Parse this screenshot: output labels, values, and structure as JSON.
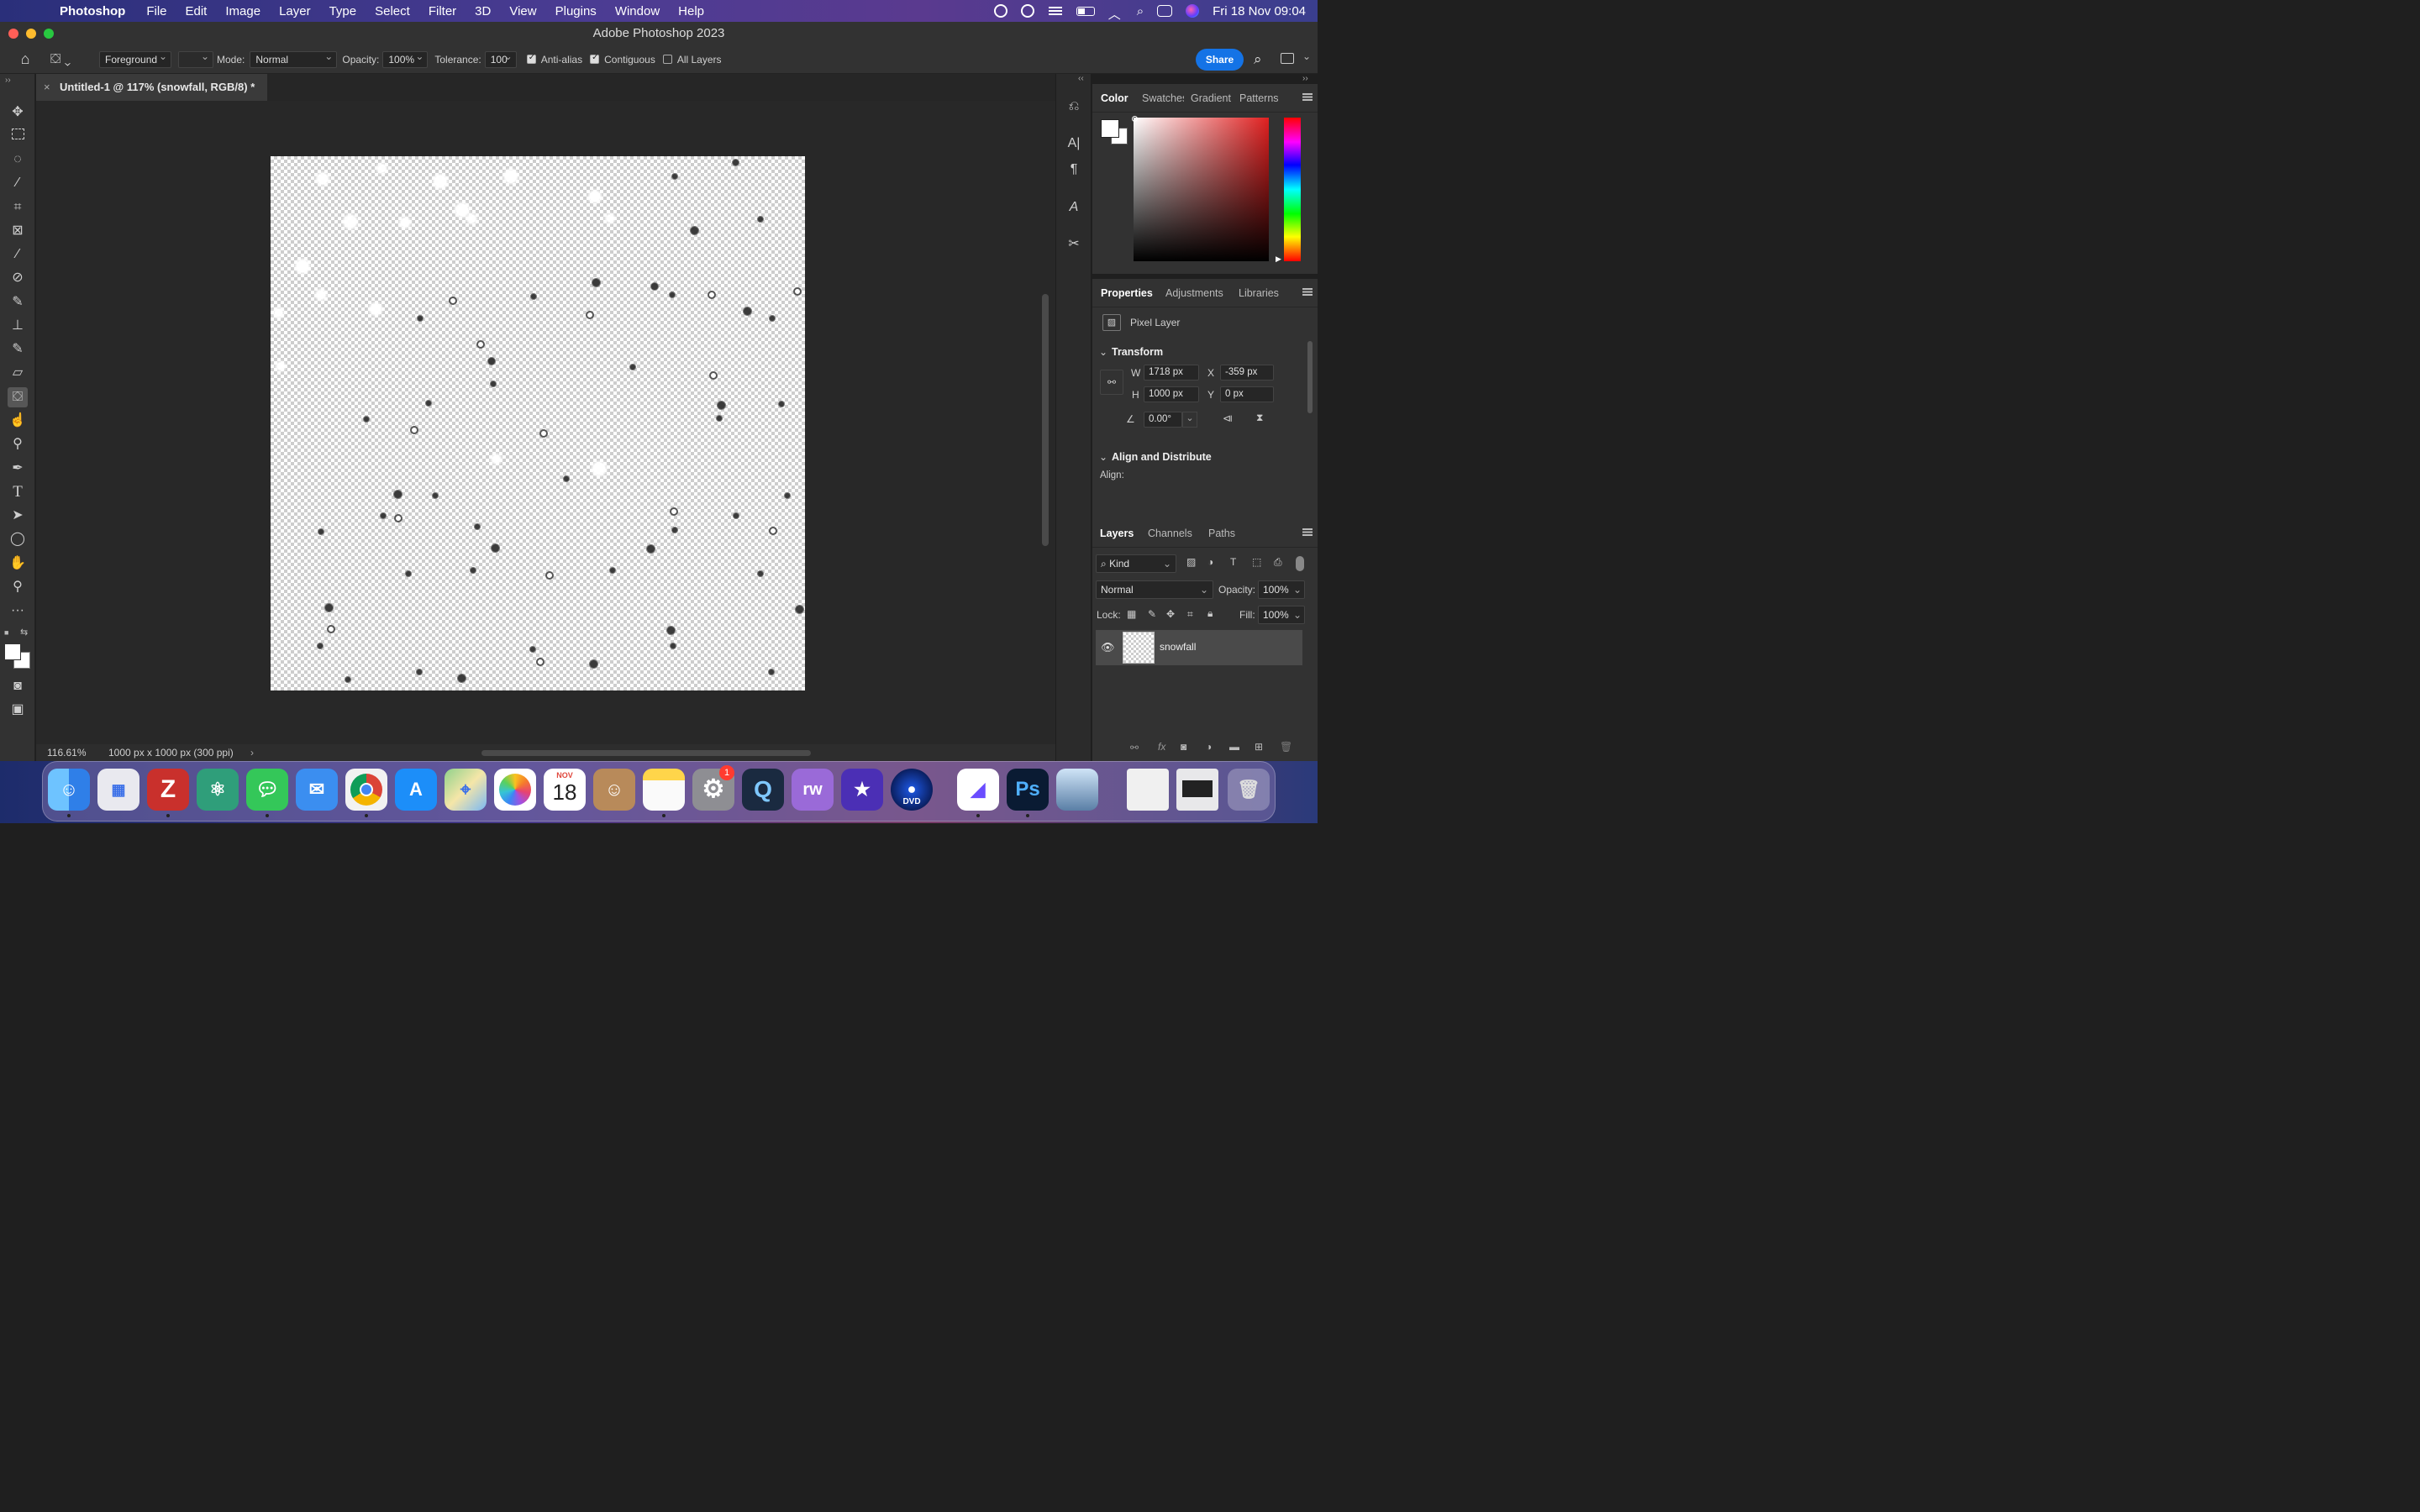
{
  "menubar": {
    "app_name": "Photoshop",
    "items": [
      "File",
      "Edit",
      "Image",
      "Layer",
      "Type",
      "Select",
      "Filter",
      "3D",
      "View",
      "Plugins",
      "Window",
      "Help"
    ],
    "clock": "Fri 18 Nov  09:04"
  },
  "window": {
    "title": "Adobe Photoshop 2023"
  },
  "options": {
    "fill_source": "Foreground",
    "mode_label": "Mode:",
    "mode_value": "Normal",
    "opacity_label": "Opacity:",
    "opacity_value": "100%",
    "tolerance_label": "Tolerance:",
    "tolerance_value": "100",
    "antialias_label": "Anti-alias",
    "contiguous_label": "Contiguous",
    "all_layers_label": "All Layers",
    "antialias_checked": true,
    "contiguous_checked": true,
    "all_layers_checked": false,
    "share_label": "Share"
  },
  "document": {
    "tab_title": "Untitled-1 @ 117% (snowfall, RGB/8) *",
    "zoom": "116.61%",
    "size_info": "1000 px x 1000 px (300 ppi)"
  },
  "color_panel": {
    "tabs": [
      "Color",
      "Swatches",
      "Gradient",
      "Patterns"
    ],
    "active_tab": "Color"
  },
  "properties_panel": {
    "tabs": [
      "Properties",
      "Adjustments",
      "Libraries"
    ],
    "layer_type": "Pixel Layer",
    "transform_title": "Transform",
    "w_label": "W",
    "w_value": "1718 px",
    "h_label": "H",
    "h_value": "1000 px",
    "x_label": "X",
    "x_value": "-359 px",
    "y_label": "Y",
    "y_value": "0 px",
    "angle_value": "0.00°",
    "align_title": "Align and Distribute",
    "align_label": "Align:"
  },
  "layers_panel": {
    "tabs": [
      "Layers",
      "Channels",
      "Paths"
    ],
    "filter_kind": "Kind",
    "blend_mode": "Normal",
    "opacity_label": "Opacity:",
    "opacity_value": "100%",
    "lock_label": "Lock:",
    "fill_label": "Fill:",
    "fill_value": "100%",
    "layers": [
      {
        "name": "snowfall",
        "visible": true
      }
    ]
  },
  "dock": {
    "calendar_month": "NOV",
    "calendar_day": "18",
    "settings_badge": "1",
    "apps": [
      "Finder",
      "Launchpad",
      "Zotero",
      "Atom",
      "Messages",
      "Mail",
      "Chrome",
      "App Store",
      "Maps",
      "Photos",
      "Calendar",
      "Contacts",
      "Notes",
      "System Settings",
      "QuickTime",
      "Roadmap",
      "iMovie",
      "DVD Player",
      "Affinity",
      "Photoshop",
      "Preview",
      "Documents",
      "Screenshots",
      "Trash"
    ]
  },
  "colors": {
    "accent": "#1473e6",
    "panel_bg": "#323232",
    "canvas_bg": "#282828"
  }
}
